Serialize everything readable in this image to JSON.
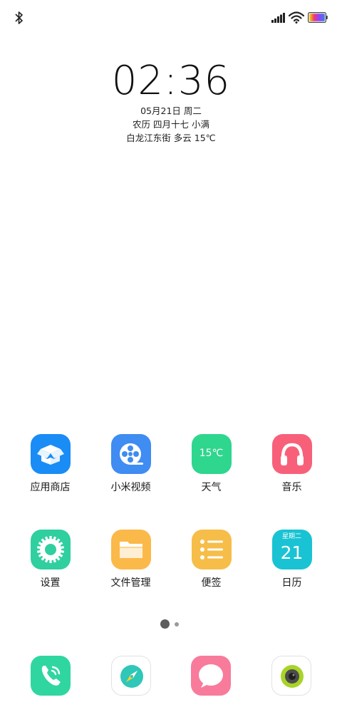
{
  "status_bar": {
    "icons": [
      "bluetooth-icon",
      "signal-icon",
      "wifi-icon",
      "battery-icon"
    ]
  },
  "clock": {
    "time": "02:36",
    "date": "05月21日 周二",
    "lunar": "农历 四月十七 小满",
    "weather": "白龙江东街 多云 15℃"
  },
  "apps": [
    {
      "label": "应用商店",
      "icon": "app-store-icon",
      "color": "#1a8cf5"
    },
    {
      "label": "小米视频",
      "icon": "video-icon",
      "color": "#3f8cf2"
    },
    {
      "label": "天气",
      "icon": "weather-icon",
      "color": "#2fd68e",
      "icon_text": "15℃"
    },
    {
      "label": "音乐",
      "icon": "headphones-icon",
      "color": "#f8607a"
    },
    {
      "label": "设置",
      "icon": "settings-icon",
      "color": "#2fcfa0"
    },
    {
      "label": "文件管理",
      "icon": "folder-icon",
      "color": "#fbb94a"
    },
    {
      "label": "便签",
      "icon": "notes-icon",
      "color": "#f6bd48"
    },
    {
      "label": "日历",
      "icon": "calendar-icon",
      "color": "#19c3d3",
      "weekday": "星期二",
      "day": "21"
    }
  ],
  "page_indicator": {
    "pages": 2,
    "current": 1
  },
  "dock": [
    {
      "icon": "phone-icon",
      "color": "#2fd6a0"
    },
    {
      "icon": "browser-compass-icon",
      "color": "#ffffff"
    },
    {
      "icon": "messages-icon",
      "color": "#f87b9b"
    },
    {
      "icon": "camera-icon",
      "color": "#ffffff"
    }
  ]
}
